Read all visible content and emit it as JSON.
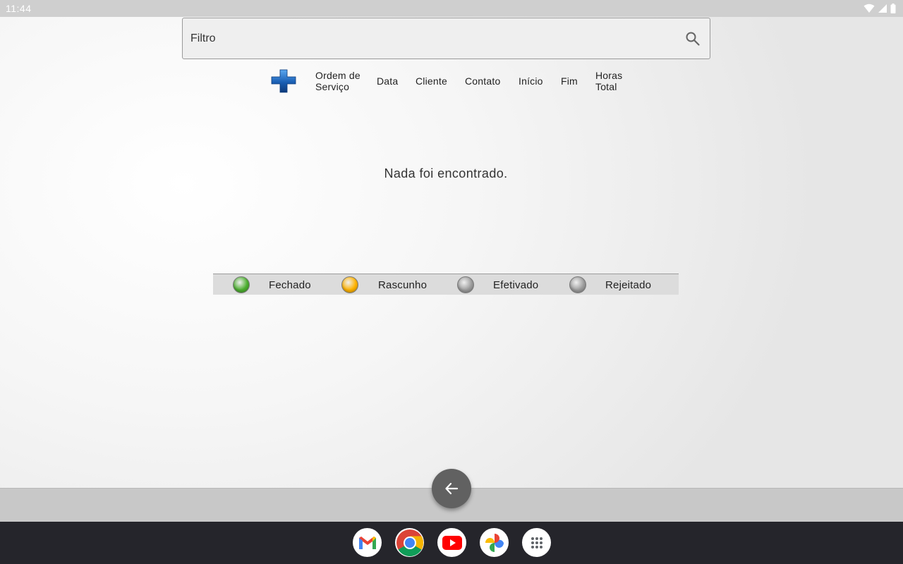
{
  "status_bar": {
    "time": "11:44",
    "icons": [
      "wifi-icon",
      "signal-icon",
      "battery-icon"
    ]
  },
  "search": {
    "placeholder": "Filtro",
    "value": "",
    "icon": "search-icon"
  },
  "table_header": {
    "add_icon": "plus-icon",
    "columns": [
      {
        "line1": "Ordem de",
        "line2": "Serviço"
      },
      {
        "line1": "Data"
      },
      {
        "line1": "Cliente"
      },
      {
        "line1": "Contato"
      },
      {
        "line1": "Início"
      },
      {
        "line1": "Fim"
      },
      {
        "line1": "Horas",
        "line2": "Total"
      }
    ]
  },
  "empty_message": "Nada foi encontrado.",
  "legend": [
    {
      "label": "Fechado",
      "color": "#4caf2f"
    },
    {
      "label": "Rascunho",
      "color": "#ffb300"
    },
    {
      "label": "Efetivado",
      "color": "#9e9e9e"
    },
    {
      "label": "Rejeitado",
      "color": "#9e9e9e"
    }
  ],
  "back_button": {
    "icon": "arrow-left-icon"
  },
  "dock": {
    "apps": [
      "gmail-icon",
      "chrome-icon",
      "youtube-icon",
      "photos-icon",
      "app-drawer-icon"
    ]
  },
  "colors": {
    "accent_plus": "#1a5fb4",
    "fab": "#616161",
    "dock_bg": "#25252b"
  }
}
